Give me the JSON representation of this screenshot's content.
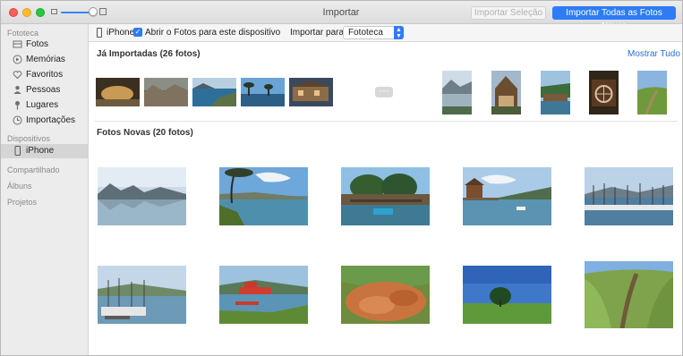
{
  "window": {
    "title": "Importar",
    "import_selection_label": "Importar Seleção",
    "import_all_label": "Importar Todas as Fotos Novas"
  },
  "sidebar": {
    "sections": [
      {
        "title": "Fototeca",
        "items": [
          {
            "label": "Fotos",
            "icon": "photos-icon"
          },
          {
            "label": "Memórias",
            "icon": "memories-icon"
          },
          {
            "label": "Favoritos",
            "icon": "heart-icon"
          },
          {
            "label": "Pessoas",
            "icon": "person-icon"
          },
          {
            "label": "Lugares",
            "icon": "pin-icon"
          },
          {
            "label": "Importações",
            "icon": "clock-icon"
          }
        ]
      },
      {
        "title": "Dispositivos",
        "items": [
          {
            "label": "iPhone",
            "icon": "iphone-icon",
            "selected": true
          }
        ]
      },
      {
        "title": "Compartilhado",
        "items": []
      },
      {
        "title": "Álbuns",
        "items": []
      },
      {
        "title": "Projetos",
        "items": []
      }
    ]
  },
  "topbar": {
    "device": "iPhone",
    "open_photos_checkbox": "Abrir o Fotos para este dispositivo",
    "open_photos_checked": true,
    "import_to_label": "Importar para:",
    "import_to_value": "Fototeca"
  },
  "already_imported": {
    "heading": "Já Importadas (26 fotos)",
    "show_all_label": "Mostrar Tudo"
  },
  "new_photos": {
    "heading": "Fotos Novas (20 fotos)"
  },
  "colors": {
    "accent": "#2d7cf6",
    "link": "#2d6fd6"
  }
}
